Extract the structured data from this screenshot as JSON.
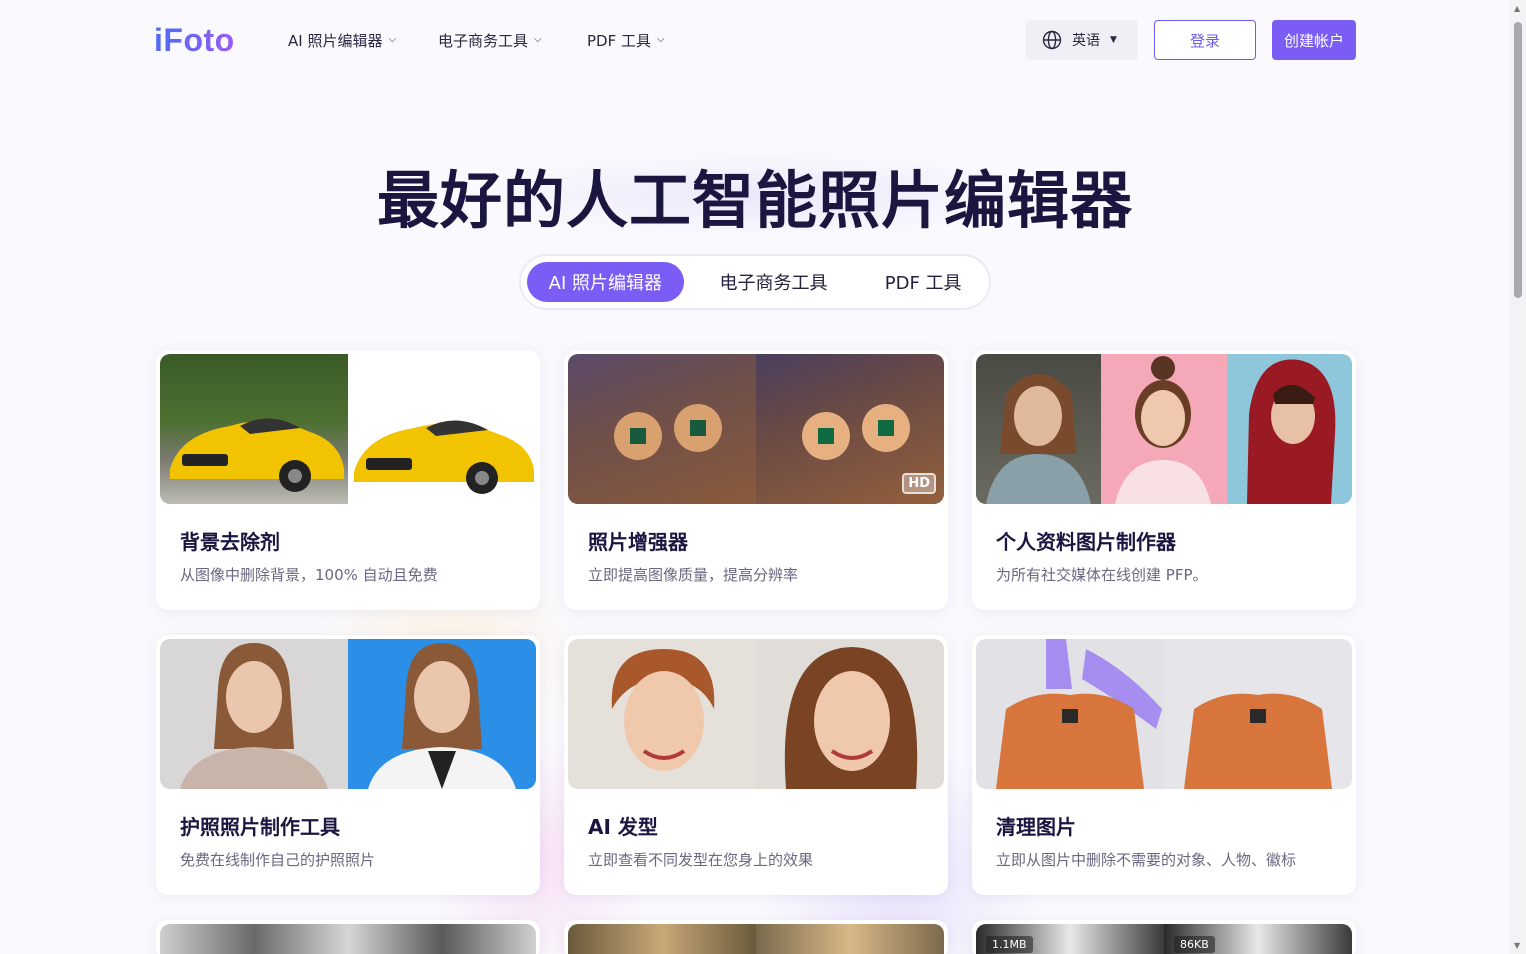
{
  "header": {
    "logo": "iFoto",
    "nav": [
      {
        "label": "AI 照片编辑器"
      },
      {
        "label": "电子商务工具"
      },
      {
        "label": "PDF 工具"
      }
    ],
    "language": "英语",
    "login_label": "登录",
    "signup_label": "创建帐户"
  },
  "hero": {
    "title": "最好的人工智能照片编辑器"
  },
  "tabs": [
    {
      "label": "AI 照片编辑器",
      "active": true
    },
    {
      "label": "电子商务工具",
      "active": false
    },
    {
      "label": "PDF 工具",
      "active": false
    }
  ],
  "cards": [
    {
      "title": "背景去除剂",
      "desc": "从图像中删除背景，100% 自动且免费"
    },
    {
      "title": "照片增强器",
      "desc": "立即提高图像质量，提高分辨率",
      "badge": "HD"
    },
    {
      "title": "个人资料图片制作器",
      "desc": "为所有社交媒体在线创建 PFP。"
    },
    {
      "title": "护照照片制作工具",
      "desc": "免费在线制作自己的护照照片"
    },
    {
      "title": "AI 发型",
      "desc": "立即查看不同发型在您身上的效果"
    },
    {
      "title": "清理图片",
      "desc": "立即从图片中删除不需要的对象、人物、徽标"
    }
  ],
  "partial_cards": {
    "size_before": "1.1MB",
    "size_after": "86KB"
  },
  "colors": {
    "accent": "#7b5cf5",
    "title": "#1a1640"
  }
}
